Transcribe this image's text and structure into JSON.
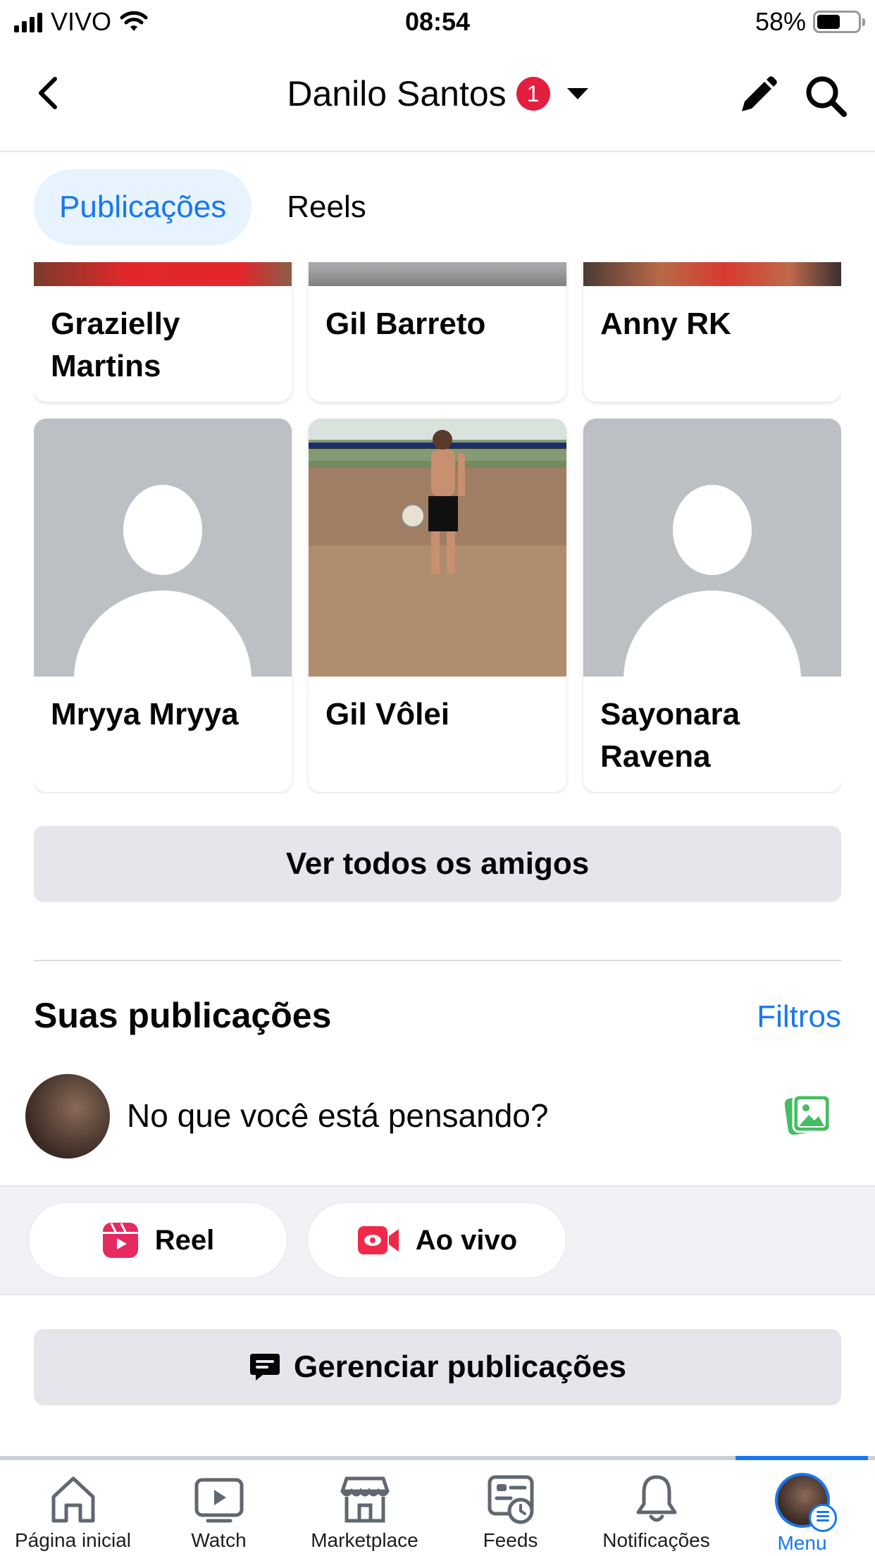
{
  "status_bar": {
    "carrier": "VIVO",
    "time": "08:54",
    "battery": "58%",
    "battery_level": 0.58
  },
  "header": {
    "title": "Danilo Santos",
    "badge_count": "1"
  },
  "tabs": [
    {
      "label": "Publicações",
      "active": true
    },
    {
      "label": "Reels",
      "active": false
    }
  ],
  "friends": {
    "row1": [
      {
        "name": "Grazielly Martins"
      },
      {
        "name": "Gil Barreto"
      },
      {
        "name": "Anny RK"
      }
    ],
    "row2": [
      {
        "name": "Mryya Mryya",
        "photo": "default-silhouette"
      },
      {
        "name": "Gil Vôlei",
        "photo": "beach-volleyball-photo"
      },
      {
        "name": "Sayonara Ravena",
        "photo": "default-silhouette"
      }
    ],
    "see_all_label": "Ver todos os amigos"
  },
  "posts_section": {
    "title": "Suas publicações",
    "filters_label": "Filtros",
    "composer_prompt": "No que você está pensando?",
    "actions": [
      {
        "label": "Reel",
        "icon": "reel-icon",
        "color": "#e42a60"
      },
      {
        "label": "Ao vivo",
        "icon": "live-video-icon",
        "color": "#f02849"
      }
    ],
    "manage_label": "Gerenciar publicações"
  },
  "bottom_nav": [
    {
      "label": "Página inicial",
      "icon": "home-icon"
    },
    {
      "label": "Watch",
      "icon": "watch-icon"
    },
    {
      "label": "Marketplace",
      "icon": "marketplace-icon"
    },
    {
      "label": "Feeds",
      "icon": "feeds-icon"
    },
    {
      "label": "Notificações",
      "icon": "bell-icon"
    },
    {
      "label": "Menu",
      "icon": "menu-avatar",
      "active": true
    }
  ],
  "colors": {
    "accent": "#1877f2",
    "badge": "#e41e3f",
    "button_grey": "#e4e6eb",
    "photo_green": "#45bd62"
  }
}
